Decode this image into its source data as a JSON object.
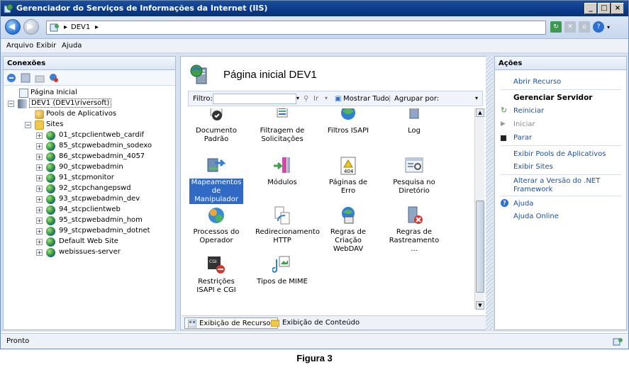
{
  "window": {
    "title": "Gerenciador do Serviços de Informações da Internet (IIS)",
    "controls": [
      "_",
      "□",
      "×"
    ]
  },
  "address": {
    "crumbs": [
      "DEV1",
      "▸"
    ]
  },
  "menu": {
    "items": [
      "Arquivo",
      "Exibir",
      "Ajuda"
    ]
  },
  "connections": {
    "header": "Conexões",
    "tree": [
      {
        "label": "Página Inicial",
        "level": 0,
        "icon": "home-icon"
      },
      {
        "label": "DEV1 (DEV1\\riversoft)",
        "level": 0,
        "icon": "server-icon",
        "expanded": true,
        "selected": true
      },
      {
        "label": "Pools de Aplicativos",
        "level": 1,
        "icon": "app-pool-icon"
      },
      {
        "label": "Sites",
        "level": 1,
        "icon": "sites-folder-icon",
        "expanded": true
      },
      {
        "label": "01_stcpclientweb_cardif",
        "level": 2,
        "icon": "site-globe-icon"
      },
      {
        "label": "85_stcpwebadmin_sodexo",
        "level": 2,
        "icon": "site-globe-icon"
      },
      {
        "label": "86_stcpwebadmin_4057",
        "level": 2,
        "icon": "site-globe-icon"
      },
      {
        "label": "90_stcpwebadmin",
        "level": 2,
        "icon": "site-globe-icon"
      },
      {
        "label": "91_stcpmonitor",
        "level": 2,
        "icon": "site-globe-icon"
      },
      {
        "label": "92_stcpchangepswd",
        "level": 2,
        "icon": "site-globe-icon"
      },
      {
        "label": "93_stcpwebadmin_dev",
        "level": 2,
        "icon": "site-globe-icon"
      },
      {
        "label": "94_stcpclientweb",
        "level": 2,
        "icon": "site-globe-icon"
      },
      {
        "label": "95_stcpwebadmin_hom",
        "level": 2,
        "icon": "site-globe-icon"
      },
      {
        "label": "99_stcpwebadmin_dotnet",
        "level": 2,
        "icon": "site-globe-icon"
      },
      {
        "label": "Default Web Site",
        "level": 2,
        "icon": "site-globe-icon"
      },
      {
        "label": "webissues-server",
        "level": 2,
        "icon": "site-globe-icon"
      }
    ]
  },
  "main": {
    "title": "Página inicial DEV1",
    "filter": {
      "label": "Filtro:",
      "go": "Ir",
      "show_all": "Mostrar Tudo",
      "group_by": "Agrupar por:"
    },
    "features": [
      [
        "Documento Padrão",
        "Filtragem de Solicitações",
        "Filtros ISAPI",
        "Log"
      ],
      [
        "Mapeamentos de Manipulador",
        "Módulos",
        "Páginas de Erro",
        "Pesquisa no Diretório"
      ],
      [
        "Processos do Operador",
        "Redirecionamento HTTP",
        "Regras de Criação WebDAV",
        "Regras de Rastreamento ..."
      ],
      [
        "Restrições ISAPI e CGI",
        "Tipos de MIME"
      ]
    ],
    "view_tabs": [
      "Exibição de Recursos",
      "Exibição de Conteúdo"
    ]
  },
  "actions": {
    "header": "Ações",
    "open_feature": "Abrir Recurso",
    "manage_server_header": "Gerenciar Servidor",
    "restart": "Reiniciar",
    "start": "Iniciar",
    "stop": "Parar",
    "view_app_pools": "Exibir Pools de Aplicativos",
    "view_sites": "Exibir Sites",
    "change_net_version": "Alterar a Versão do .NET Framework",
    "help": "Ajuda",
    "online_help": "Ajuda Online"
  },
  "status": {
    "text": "Pronto"
  },
  "caption": "Figura 3"
}
